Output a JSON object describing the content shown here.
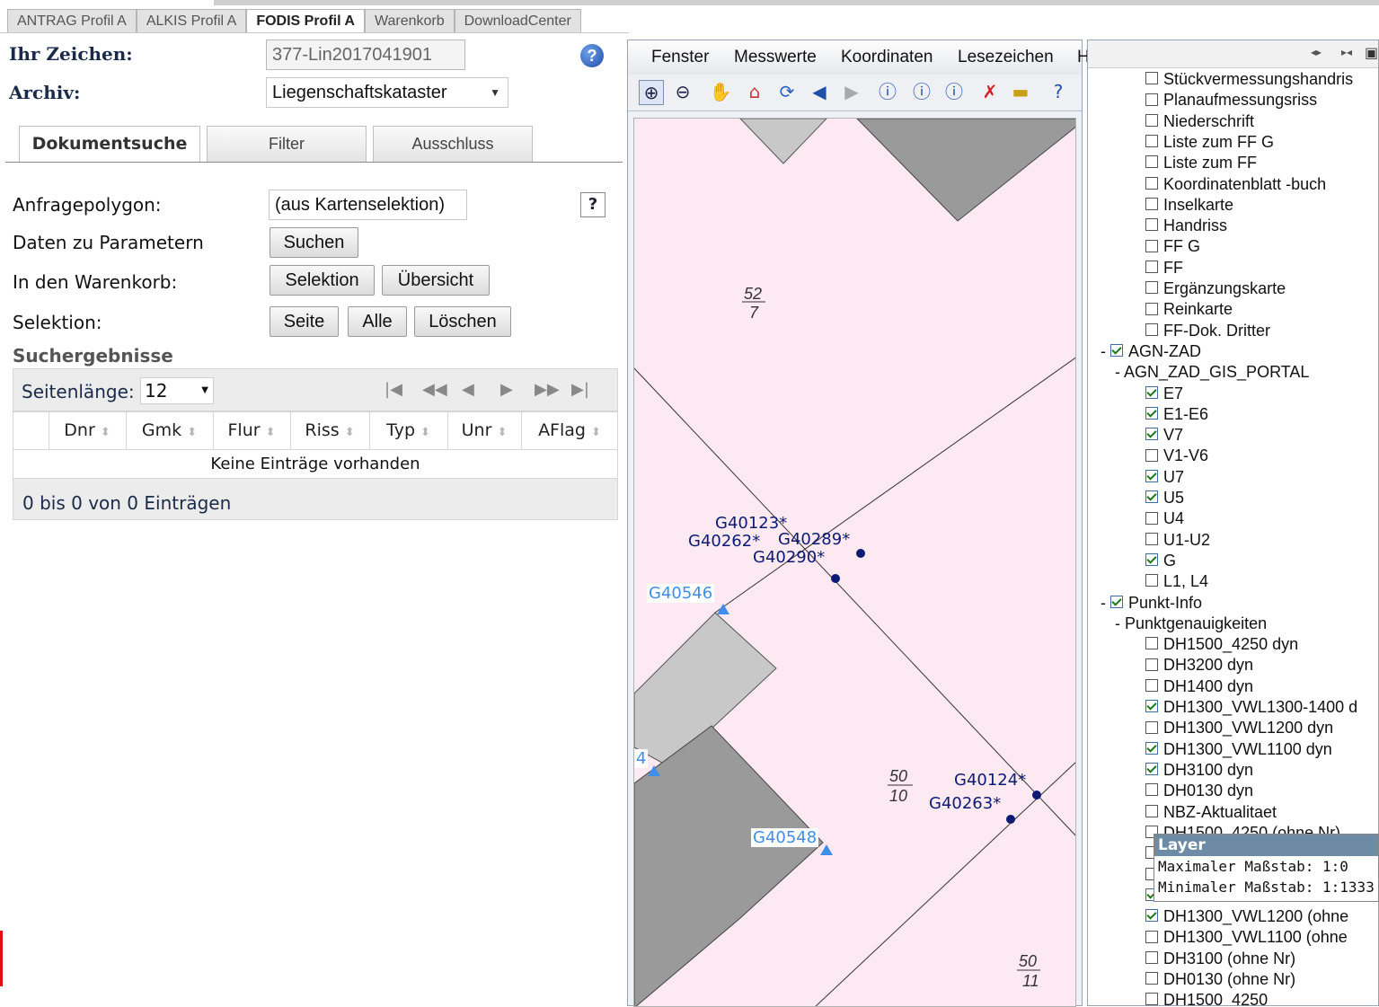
{
  "tabs": [
    "ANTRAG Profil A",
    "ALKIS Profil A",
    "FODIS Profil A",
    "Warenkorb",
    "DownloadCenter"
  ],
  "active_tab": "FODIS Profil A",
  "form": {
    "zeichen_label": "Ihr Zeichen:",
    "zeichen_value": "377-Lin2017041901",
    "archiv_label": "Archiv:",
    "archiv_value": "Liegenschaftskataster"
  },
  "subtabs": [
    "Dokumentsuche",
    "Filter",
    "Ausschluss"
  ],
  "query": {
    "anfragepolygon_label": "Anfragepolygon:",
    "anfragepolygon_value": "(aus Kartenselektion)",
    "daten_label": "Daten zu Parametern",
    "suchen_button": "Suchen",
    "warenkorb_label": "In den Warenkorb:",
    "selektion_button": "Selektion",
    "uebersicht_button": "Übersicht",
    "selektion_label": "Selektion:",
    "seite_button": "Seite",
    "alle_button": "Alle",
    "loeschen_button": "Löschen",
    "help_q": "?"
  },
  "results": {
    "title": "Suchergebnisse",
    "page_length_label": "Seitenlänge:",
    "page_length_value": "12",
    "columns": [
      "Dnr",
      "Gmk",
      "Flur",
      "Riss",
      "Typ",
      "Unr",
      "AFlag"
    ],
    "empty_text": "Keine Einträge vorhanden",
    "footer_text": "0 bis 0 von 0 Einträgen"
  },
  "map": {
    "menu": [
      "Fenster",
      "Messwerte",
      "Koordinaten",
      "Lesezeichen",
      "Hilfe"
    ],
    "tools": [
      "zoom-in-icon",
      "zoom-out-icon",
      "pan-hand-icon",
      "home-icon",
      "refresh-icon",
      "back-icon",
      "forward-icon",
      "info-icon",
      "info2-icon",
      "info3-icon",
      "clear-selection-icon",
      "measure-icon",
      "help-icon"
    ],
    "parcels": [
      {
        "num": "52",
        "den": "7"
      },
      {
        "num": "50",
        "den": "10"
      },
      {
        "num": "50",
        "den": "11"
      }
    ],
    "points_dark": [
      "G40123*",
      "G40262*",
      "G40289*",
      "G40290*",
      "G40124*",
      "G40263*"
    ],
    "points_light": [
      "G40546",
      "G40548",
      "4"
    ],
    "colors": {
      "parcel_bg": "#fce9f2",
      "building_dark": "#9a9a9a",
      "building_light": "#c8c8c8",
      "point_dark": "#0b1a73",
      "point_light": "#3f8ee8"
    }
  },
  "layers": {
    "items": [
      {
        "label": "Stückvermessungshandris",
        "checked": false,
        "level": 2
      },
      {
        "label": "Planaufmessungsriss",
        "checked": false,
        "level": 2
      },
      {
        "label": "Niederschrift",
        "checked": false,
        "level": 2
      },
      {
        "label": "Liste zum FF G",
        "checked": false,
        "level": 2
      },
      {
        "label": "Liste zum FF",
        "checked": false,
        "level": 2
      },
      {
        "label": "Koordinatenblatt -buch",
        "checked": false,
        "level": 2
      },
      {
        "label": "Inselkarte",
        "checked": false,
        "level": 2
      },
      {
        "label": "Handriss",
        "checked": false,
        "level": 2
      },
      {
        "label": "FF G",
        "checked": false,
        "level": 2
      },
      {
        "label": "FF",
        "checked": false,
        "level": 2
      },
      {
        "label": "Ergänzungskarte",
        "checked": false,
        "level": 2
      },
      {
        "label": "Reinkarte",
        "checked": false,
        "level": 2
      },
      {
        "label": "FF-Dok. Dritter",
        "checked": false,
        "level": 2
      },
      {
        "label": "AGN-ZAD",
        "checked": true,
        "level": 0,
        "toggle": "-"
      },
      {
        "label": "AGN_ZAD_GIS_PORTAL",
        "checked": null,
        "level": 1,
        "toggle": "-"
      },
      {
        "label": "E7",
        "checked": true,
        "level": 2
      },
      {
        "label": "E1-E6",
        "checked": true,
        "level": 2
      },
      {
        "label": "V7",
        "checked": true,
        "level": 2
      },
      {
        "label": "V1-V6",
        "checked": false,
        "level": 2
      },
      {
        "label": "U7",
        "checked": true,
        "level": 2
      },
      {
        "label": "U5",
        "checked": true,
        "level": 2
      },
      {
        "label": "U4",
        "checked": false,
        "level": 2
      },
      {
        "label": "U1-U2",
        "checked": false,
        "level": 2
      },
      {
        "label": "G",
        "checked": true,
        "level": 2
      },
      {
        "label": "L1, L4",
        "checked": false,
        "level": 2
      },
      {
        "label": "Punkt-Info",
        "checked": true,
        "level": 0,
        "toggle": "-"
      },
      {
        "label": "Punktgenauigkeiten",
        "checked": null,
        "level": 1,
        "toggle": "-"
      },
      {
        "label": "DH1500_4250 dyn",
        "checked": false,
        "level": 2
      },
      {
        "label": "DH3200 dyn",
        "checked": false,
        "level": 2
      },
      {
        "label": "DH1400 dyn",
        "checked": false,
        "level": 2
      },
      {
        "label": "DH1300_VWL1300-1400 d",
        "checked": true,
        "level": 2
      },
      {
        "label": "DH1300_VWL1200 dyn",
        "checked": false,
        "level": 2
      },
      {
        "label": "DH1300_VWL1100 dyn",
        "checked": true,
        "level": 2
      },
      {
        "label": "DH3100 dyn",
        "checked": true,
        "level": 2
      },
      {
        "label": "DH0130 dyn",
        "checked": false,
        "level": 2
      },
      {
        "label": "NBZ-Aktualitaet",
        "checked": false,
        "level": 2
      },
      {
        "label": "DH1500_4250 (ohne Nr)",
        "checked": false,
        "level": 2
      },
      {
        "label": "",
        "checked": false,
        "level": 2
      },
      {
        "label": "",
        "checked": false,
        "level": 2
      },
      {
        "label": "",
        "checked": true,
        "level": 2
      },
      {
        "label": "DH1300_VWL1200 (ohne",
        "checked": true,
        "level": 2
      },
      {
        "label": "DH1300_VWL1100 (ohne",
        "checked": false,
        "level": 2
      },
      {
        "label": "DH3100 (ohne Nr)",
        "checked": false,
        "level": 2
      },
      {
        "label": "DH0130 (ohne Nr)",
        "checked": false,
        "level": 2
      },
      {
        "label": "DH1500_4250",
        "checked": false,
        "level": 2
      }
    ],
    "tooltip": {
      "title": "Layer",
      "max_scale": "Maximaler Maßstab: 1:0",
      "min_scale": "Minimaler Maßstab: 1:1333"
    }
  }
}
